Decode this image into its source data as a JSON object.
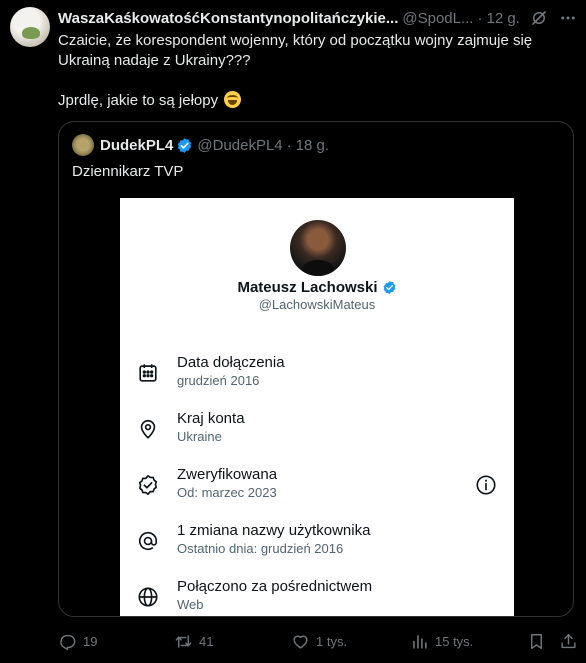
{
  "tweet": {
    "author_name": "WaszaKaśkowatośćKonstantynopolitańczykie...",
    "author_handle": "@SpodL...",
    "separator": "·",
    "time": "12 g.",
    "text": "Czaicie, że korespondent wojenny, który od początku wojny zajmuje się Ukrainą nadaje z Ukrainy???\n\nJprdlę, jakie to są jełopy",
    "emoji": "grinning-squinting-face"
  },
  "quote": {
    "author_name": "DudekPL4",
    "author_handle": "@DudekPL4",
    "separator": "·",
    "time": "18 g.",
    "text": "Dziennikarz TVP",
    "card": {
      "name": "Mateusz Lachowski",
      "handle": "@LachowskiMateus",
      "rows": [
        {
          "title": "Data dołączenia",
          "subtitle": "grudzień 2016",
          "icon": "calendar-icon"
        },
        {
          "title": "Kraj konta",
          "subtitle": "Ukraine",
          "icon": "location-pin-icon"
        },
        {
          "title": "Zweryfikowana",
          "subtitle": "Od: marzec 2023",
          "icon": "verified-badge-icon"
        },
        {
          "title": "1 zmiana nazwy użytkownika",
          "subtitle": "Ostatnio dnia: grudzień 2016",
          "icon": "at-sign-icon"
        },
        {
          "title": "Połączono za pośrednictwem",
          "subtitle": "Web",
          "icon": "globe-icon"
        }
      ]
    }
  },
  "actions": {
    "replies": "19",
    "reposts": "41",
    "likes": "1 tys.",
    "views": "15 tys."
  },
  "colors": {
    "background": "#000000",
    "text": "#e7e9ea",
    "muted": "#71767b",
    "verified": "#1d9bf0",
    "border": "#2f3336"
  }
}
